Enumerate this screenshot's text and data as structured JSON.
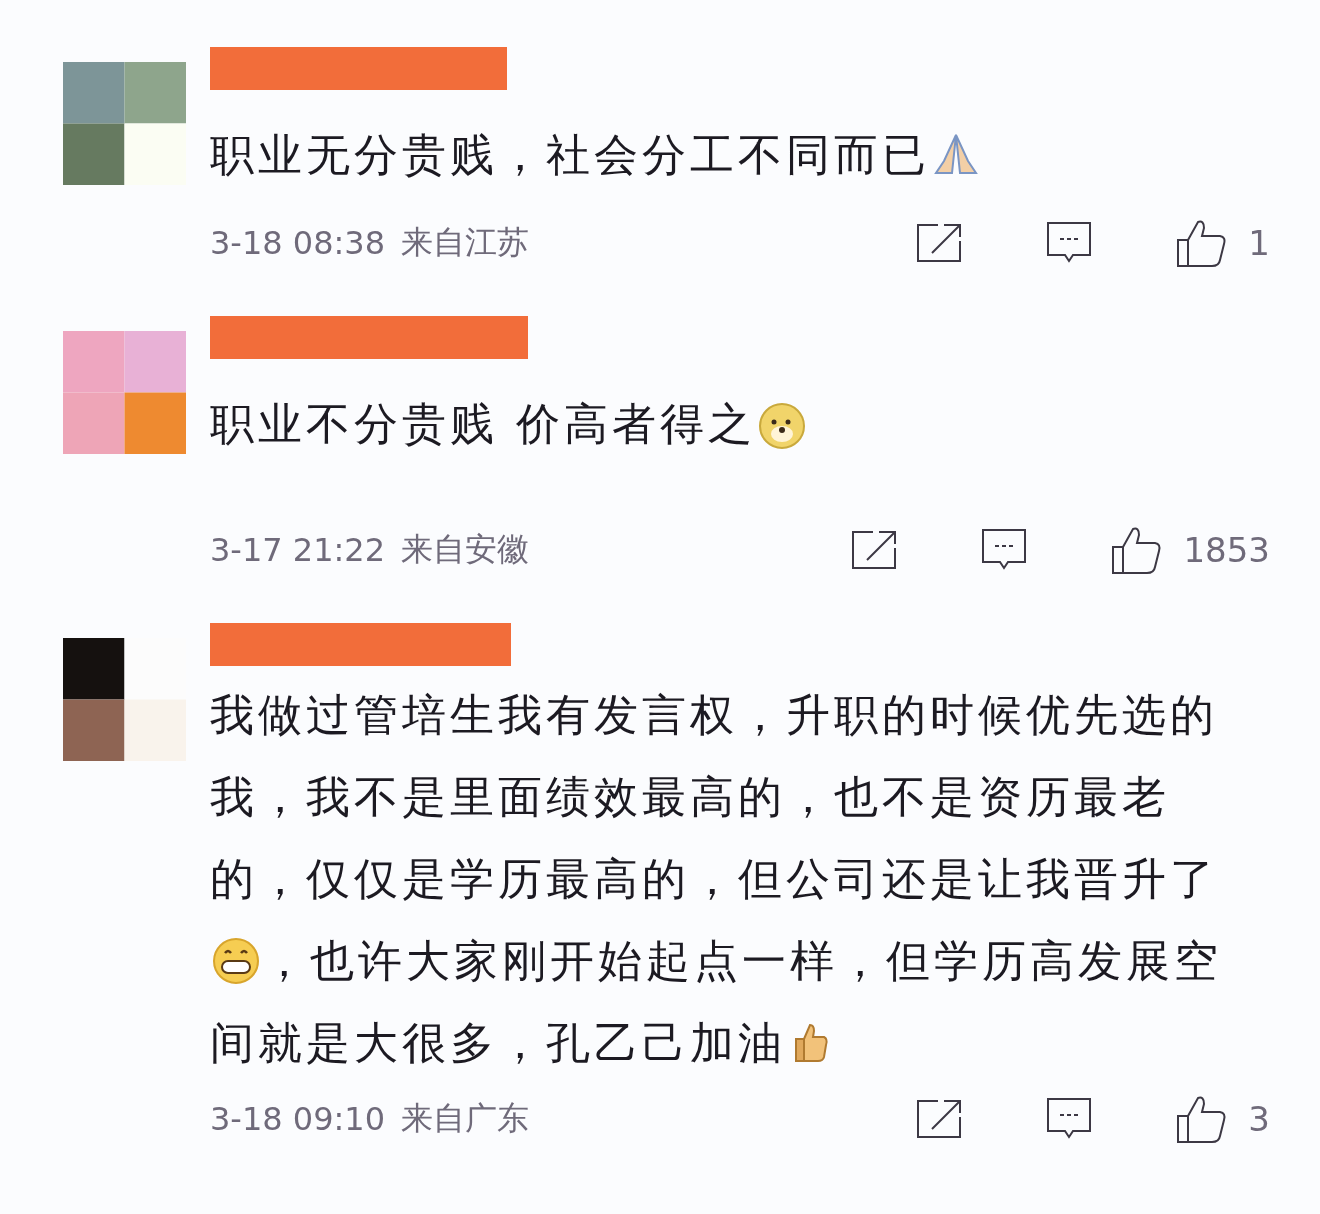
{
  "comments": [
    {
      "lines": [
        [
          {
            "kind": "text",
            "text": "职业无分贵贱，社会分工不同而已"
          },
          {
            "kind": "pray"
          }
        ]
      ],
      "time": "3-18 08:38",
      "location": "来自江苏",
      "likes": "1"
    },
    {
      "lines": [
        [
          {
            "kind": "text",
            "text": "职业不分贵贱 价高者得之"
          },
          {
            "kind": "dog"
          }
        ]
      ],
      "time": "3-17 21:22",
      "location": "来自安徽",
      "likes": "1853"
    },
    {
      "lines": [
        [
          {
            "kind": "text",
            "text": "我做过管培生我有发言权，升职的时候优先选的"
          }
        ],
        [
          {
            "kind": "text",
            "text": "我，我不是里面绩效最高的，也不是资历最老"
          }
        ],
        [
          {
            "kind": "text",
            "text": "的，仅仅是学历最高的，但公司还是让我晋升了"
          }
        ],
        [
          {
            "kind": "grin"
          },
          {
            "kind": "text",
            "text": "，也许大家刚开始起点一样，但学历高发展空"
          }
        ],
        [
          {
            "kind": "text",
            "text": "间就是大很多，孔乙己加油"
          },
          {
            "kind": "thumb"
          }
        ]
      ],
      "time": "3-18 09:10",
      "location": "来自广东",
      "likes": "3"
    }
  ]
}
